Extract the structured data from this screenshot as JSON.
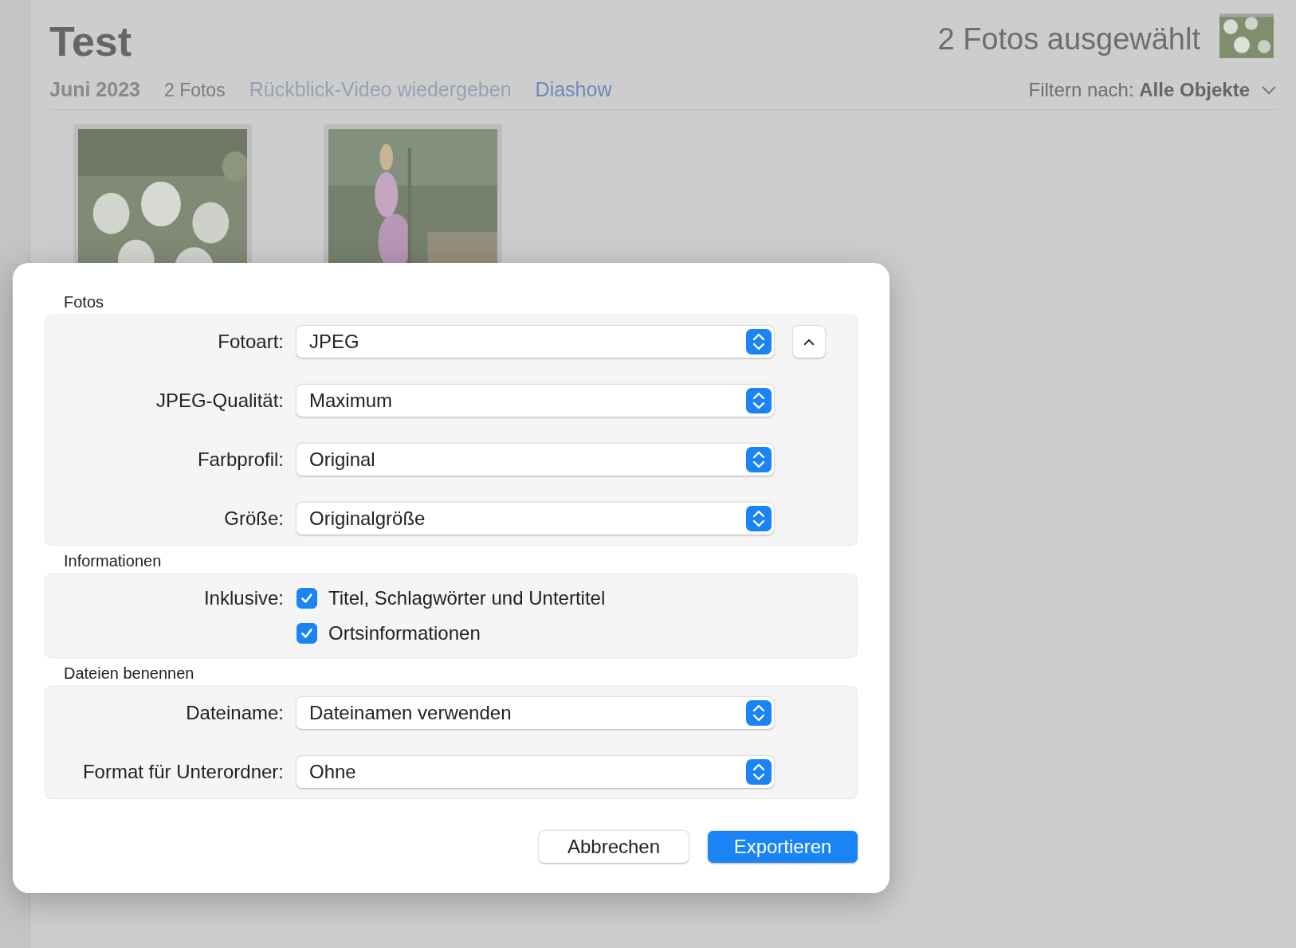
{
  "window": {
    "title": "Test",
    "selection": "2 Fotos ausgewählt"
  },
  "header": {
    "date": "Juni 2023",
    "count": "2 Fotos",
    "links": [
      {
        "label": "Rückblick-Video wiedergeben",
        "disabled": true
      },
      {
        "label": "Diashow",
        "disabled": false
      }
    ],
    "filter_label": "Filtern nach:",
    "filter_value": "Alle Objekte"
  },
  "dialog": {
    "sections": [
      {
        "title": "Fotos",
        "rows": [
          {
            "kind": "select",
            "label": "Fotoart:",
            "value": "JPEG",
            "collapse_button": true
          },
          {
            "kind": "select",
            "label": "JPEG-Qualität:",
            "value": "Maximum",
            "collapse_button": false
          },
          {
            "kind": "select",
            "label": "Farbprofil:",
            "value": "Original",
            "collapse_button": false
          },
          {
            "kind": "select",
            "label": "Größe:",
            "value": "Originalgröße",
            "collapse_button": false
          }
        ]
      },
      {
        "title": "Informationen",
        "rows": [
          {
            "kind": "checkboxes",
            "label": "Inklusive:",
            "options": [
              {
                "label": "Titel, Schlagwörter und Untertitel",
                "checked": true
              },
              {
                "label": "Ortsinformationen",
                "checked": true
              }
            ]
          }
        ]
      },
      {
        "title": "Dateien benennen",
        "rows": [
          {
            "kind": "select",
            "label": "Dateiname:",
            "value": "Dateinamen verwenden",
            "collapse_button": false
          },
          {
            "kind": "select",
            "label": "Format für Unterordner:",
            "value": "Ohne",
            "collapse_button": false
          }
        ]
      }
    ],
    "buttons": [
      {
        "label": "Abbrechen",
        "primary": false
      },
      {
        "label": "Exportieren",
        "primary": true
      }
    ]
  }
}
